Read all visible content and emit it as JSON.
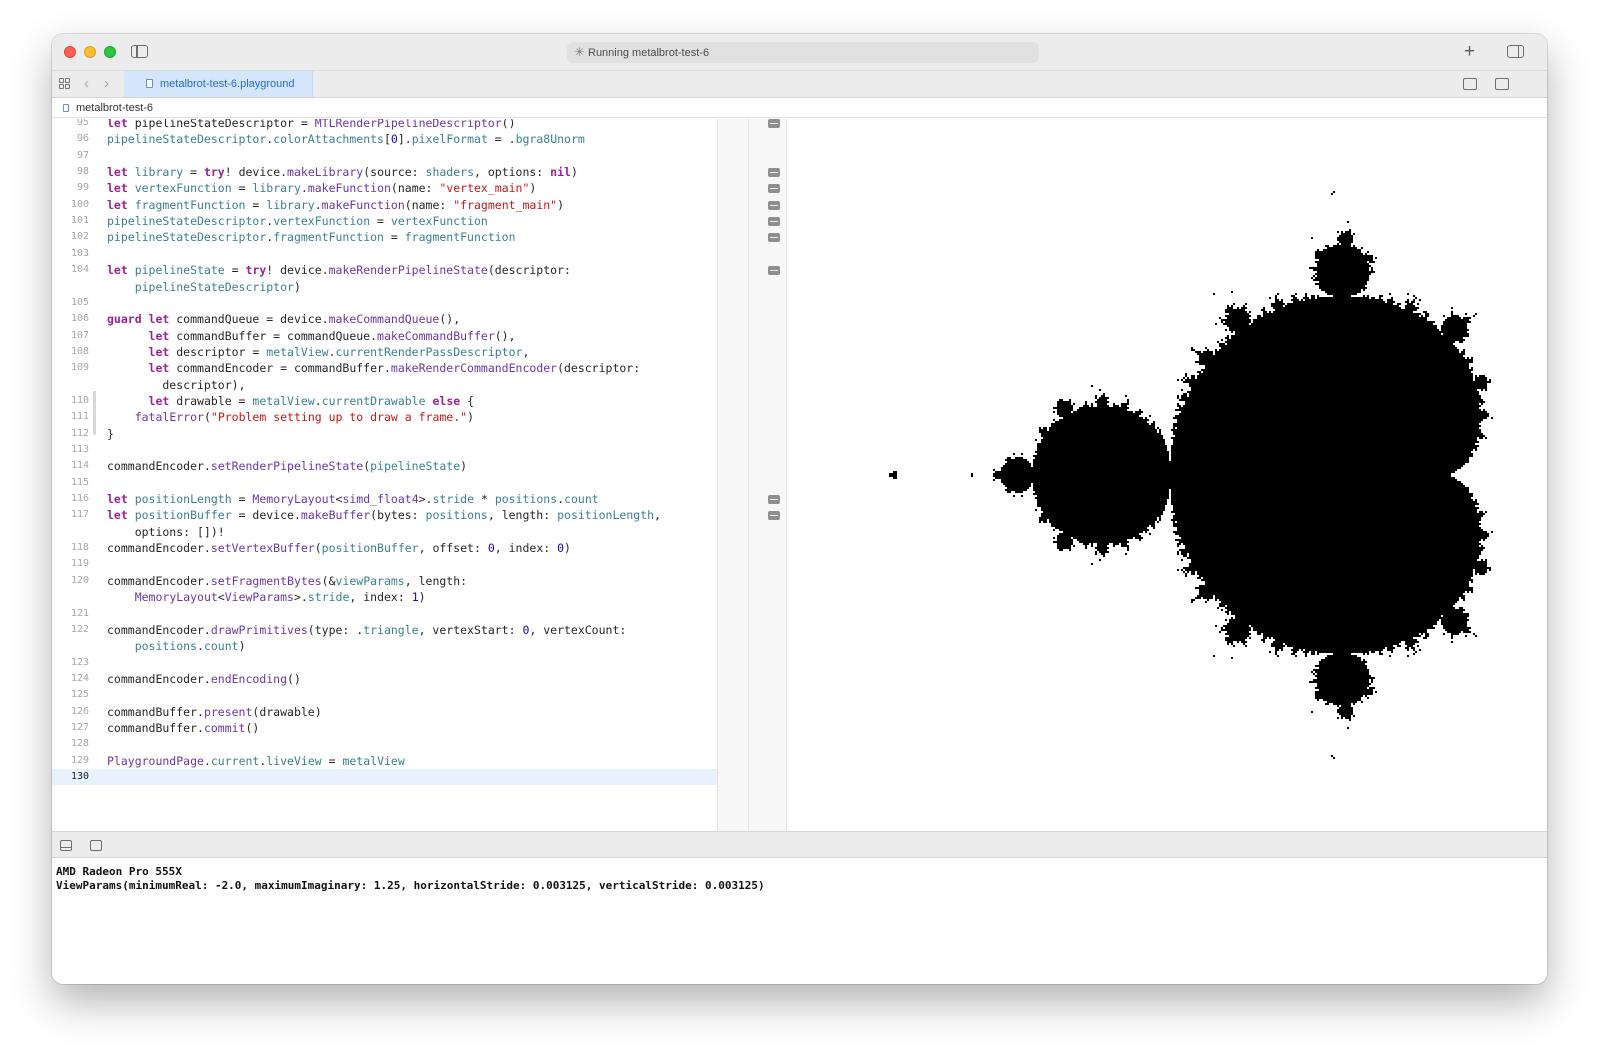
{
  "window": {
    "activity_text": "Running metalbrot-test-6",
    "tab_label": "metalbrot-test-6.playground",
    "breadcrumb": "metalbrot-test-6"
  },
  "editor": {
    "lines": [
      {
        "n": "95",
        "tokens": [
          [
            "kw",
            "let "
          ],
          [
            "pl",
            "pipelineStateDescriptor = "
          ],
          [
            "ty",
            "MTLRenderPipelineDescriptor"
          ],
          [
            "pl",
            "()"
          ]
        ]
      },
      {
        "n": "96",
        "tokens": [
          [
            "pr",
            "pipelineStateDescriptor"
          ],
          [
            "pl",
            "."
          ],
          [
            "pr",
            "colorAttachments"
          ],
          [
            "pl",
            "["
          ],
          [
            "nm",
            "0"
          ],
          [
            "pl",
            "]."
          ],
          [
            "pr",
            "pixelFormat"
          ],
          [
            "pl",
            " = ."
          ],
          [
            "pr",
            "bgra8Unorm"
          ]
        ]
      },
      {
        "n": "97",
        "tokens": []
      },
      {
        "n": "98",
        "tokens": [
          [
            "kw",
            "let "
          ],
          [
            "pr",
            "library"
          ],
          [
            "pl",
            " = "
          ],
          [
            "kw",
            "try"
          ],
          [
            "pl",
            "! device."
          ],
          [
            "fn",
            "makeLibrary"
          ],
          [
            "pl",
            "(source: "
          ],
          [
            "pr",
            "shaders"
          ],
          [
            "pl",
            ", options: "
          ],
          [
            "kw",
            "nil"
          ],
          [
            "pl",
            ")"
          ]
        ]
      },
      {
        "n": "99",
        "tokens": [
          [
            "kw",
            "let "
          ],
          [
            "pr",
            "vertexFunction"
          ],
          [
            "pl",
            " = "
          ],
          [
            "pr",
            "library"
          ],
          [
            "pl",
            "."
          ],
          [
            "fn",
            "makeFunction"
          ],
          [
            "pl",
            "(name: "
          ],
          [
            "st",
            "\"vertex_main\""
          ],
          [
            "pl",
            ")"
          ]
        ]
      },
      {
        "n": "100",
        "tokens": [
          [
            "kw",
            "let "
          ],
          [
            "pr",
            "fragmentFunction"
          ],
          [
            "pl",
            " = "
          ],
          [
            "pr",
            "library"
          ],
          [
            "pl",
            "."
          ],
          [
            "fn",
            "makeFunction"
          ],
          [
            "pl",
            "(name: "
          ],
          [
            "st",
            "\"fragment_main\""
          ],
          [
            "pl",
            ")"
          ]
        ]
      },
      {
        "n": "101",
        "tokens": [
          [
            "pr",
            "pipelineStateDescriptor"
          ],
          [
            "pl",
            "."
          ],
          [
            "pr",
            "vertexFunction"
          ],
          [
            "pl",
            " = "
          ],
          [
            "pr",
            "vertexFunction"
          ]
        ]
      },
      {
        "n": "102",
        "tokens": [
          [
            "pr",
            "pipelineStateDescriptor"
          ],
          [
            "pl",
            "."
          ],
          [
            "pr",
            "fragmentFunction"
          ],
          [
            "pl",
            " = "
          ],
          [
            "pr",
            "fragmentFunction"
          ]
        ]
      },
      {
        "n": "103",
        "tokens": []
      },
      {
        "n": "104",
        "tokens": [
          [
            "kw",
            "let "
          ],
          [
            "pr",
            "pipelineState"
          ],
          [
            "pl",
            " = "
          ],
          [
            "kw",
            "try"
          ],
          [
            "pl",
            "! device."
          ],
          [
            "fn",
            "makeRenderPipelineState"
          ],
          [
            "pl",
            "(descriptor:"
          ]
        ]
      },
      {
        "n": "",
        "tokens": [
          [
            "pl",
            "    "
          ],
          [
            "pr",
            "pipelineStateDescriptor"
          ],
          [
            "pl",
            ")"
          ]
        ]
      },
      {
        "n": "105",
        "tokens": []
      },
      {
        "n": "106",
        "tokens": [
          [
            "kw",
            "guard let "
          ],
          [
            "pl",
            "commandQueue = device."
          ],
          [
            "fn",
            "makeCommandQueue"
          ],
          [
            "pl",
            "(),"
          ]
        ]
      },
      {
        "n": "107",
        "tokens": [
          [
            "pl",
            "      "
          ],
          [
            "kw",
            "let "
          ],
          [
            "pl",
            "commandBuffer = commandQueue."
          ],
          [
            "fn",
            "makeCommandBuffer"
          ],
          [
            "pl",
            "(),"
          ]
        ]
      },
      {
        "n": "108",
        "tokens": [
          [
            "pl",
            "      "
          ],
          [
            "kw",
            "let "
          ],
          [
            "pl",
            "descriptor = "
          ],
          [
            "pr",
            "metalView"
          ],
          [
            "pl",
            "."
          ],
          [
            "pr",
            "currentRenderPassDescriptor"
          ],
          [
            "pl",
            ","
          ]
        ]
      },
      {
        "n": "109",
        "tokens": [
          [
            "pl",
            "      "
          ],
          [
            "kw",
            "let "
          ],
          [
            "pl",
            "commandEncoder = commandBuffer."
          ],
          [
            "fn",
            "makeRenderCommandEncoder"
          ],
          [
            "pl",
            "(descriptor:"
          ]
        ]
      },
      {
        "n": "",
        "tokens": [
          [
            "pl",
            "        descriptor),"
          ]
        ]
      },
      {
        "n": "110",
        "tokens": [
          [
            "pl",
            "      "
          ],
          [
            "kw",
            "let "
          ],
          [
            "pl",
            "drawable = "
          ],
          [
            "pr",
            "metalView"
          ],
          [
            "pl",
            "."
          ],
          [
            "pr",
            "currentDrawable"
          ],
          [
            "pl",
            " "
          ],
          [
            "kw",
            "else"
          ],
          [
            "pl",
            " {"
          ]
        ]
      },
      {
        "n": "111",
        "tokens": [
          [
            "pl",
            "    "
          ],
          [
            "fn",
            "fatalError"
          ],
          [
            "pl",
            "("
          ],
          [
            "st",
            "\"Problem setting up to draw a frame.\""
          ],
          [
            "pl",
            ")"
          ]
        ]
      },
      {
        "n": "112",
        "tokens": [
          [
            "pl",
            "}"
          ]
        ]
      },
      {
        "n": "113",
        "tokens": []
      },
      {
        "n": "114",
        "tokens": [
          [
            "pl",
            "commandEncoder."
          ],
          [
            "fn",
            "setRenderPipelineState"
          ],
          [
            "pl",
            "("
          ],
          [
            "pr",
            "pipelineState"
          ],
          [
            "pl",
            ")"
          ]
        ]
      },
      {
        "n": "115",
        "tokens": []
      },
      {
        "n": "116",
        "tokens": [
          [
            "kw",
            "let "
          ],
          [
            "pr",
            "positionLength"
          ],
          [
            "pl",
            " = "
          ],
          [
            "ty",
            "MemoryLayout"
          ],
          [
            "pl",
            "<"
          ],
          [
            "ty",
            "simd_float4"
          ],
          [
            "pl",
            ">."
          ],
          [
            "pr",
            "stride"
          ],
          [
            "pl",
            " * "
          ],
          [
            "pr",
            "positions"
          ],
          [
            "pl",
            "."
          ],
          [
            "pr",
            "count"
          ]
        ]
      },
      {
        "n": "117",
        "tokens": [
          [
            "kw",
            "let "
          ],
          [
            "pr",
            "positionBuffer"
          ],
          [
            "pl",
            " = device."
          ],
          [
            "fn",
            "makeBuffer"
          ],
          [
            "pl",
            "(bytes: "
          ],
          [
            "pr",
            "positions"
          ],
          [
            "pl",
            ", length: "
          ],
          [
            "pr",
            "positionLength"
          ],
          [
            "pl",
            ","
          ]
        ]
      },
      {
        "n": "",
        "tokens": [
          [
            "pl",
            "    options: [])!"
          ]
        ]
      },
      {
        "n": "118",
        "tokens": [
          [
            "pl",
            "commandEncoder."
          ],
          [
            "fn",
            "setVertexBuffer"
          ],
          [
            "pl",
            "("
          ],
          [
            "pr",
            "positionBuffer"
          ],
          [
            "pl",
            ", offset: "
          ],
          [
            "nm",
            "0"
          ],
          [
            "pl",
            ", index: "
          ],
          [
            "nm",
            "0"
          ],
          [
            "pl",
            ")"
          ]
        ]
      },
      {
        "n": "119",
        "tokens": []
      },
      {
        "n": "120",
        "tokens": [
          [
            "pl",
            "commandEncoder."
          ],
          [
            "fn",
            "setFragmentBytes"
          ],
          [
            "pl",
            "(&"
          ],
          [
            "pr",
            "viewParams"
          ],
          [
            "pl",
            ", length:"
          ]
        ]
      },
      {
        "n": "",
        "tokens": [
          [
            "pl",
            "    "
          ],
          [
            "ty",
            "MemoryLayout"
          ],
          [
            "pl",
            "<"
          ],
          [
            "ty",
            "ViewParams"
          ],
          [
            "pl",
            ">."
          ],
          [
            "pr",
            "stride"
          ],
          [
            "pl",
            ", index: "
          ],
          [
            "nm",
            "1"
          ],
          [
            "pl",
            ")"
          ]
        ]
      },
      {
        "n": "121",
        "tokens": []
      },
      {
        "n": "122",
        "tokens": [
          [
            "pl",
            "commandEncoder."
          ],
          [
            "fn",
            "drawPrimitives"
          ],
          [
            "pl",
            "(type: ."
          ],
          [
            "pr",
            "triangle"
          ],
          [
            "pl",
            ", vertexStart: "
          ],
          [
            "nm",
            "0"
          ],
          [
            "pl",
            ", vertexCount:"
          ]
        ]
      },
      {
        "n": "",
        "tokens": [
          [
            "pl",
            "    "
          ],
          [
            "pr",
            "positions"
          ],
          [
            "pl",
            "."
          ],
          [
            "pr",
            "count"
          ],
          [
            "pl",
            ")"
          ]
        ]
      },
      {
        "n": "123",
        "tokens": []
      },
      {
        "n": "124",
        "tokens": [
          [
            "pl",
            "commandEncoder."
          ],
          [
            "fn",
            "endEncoding"
          ],
          [
            "pl",
            "()"
          ]
        ]
      },
      {
        "n": "125",
        "tokens": []
      },
      {
        "n": "126",
        "tokens": [
          [
            "pl",
            "commandBuffer."
          ],
          [
            "fn",
            "present"
          ],
          [
            "pl",
            "(drawable)"
          ]
        ]
      },
      {
        "n": "127",
        "tokens": [
          [
            "pl",
            "commandBuffer."
          ],
          [
            "fn",
            "commit"
          ],
          [
            "pl",
            "()"
          ]
        ]
      },
      {
        "n": "128",
        "tokens": []
      },
      {
        "n": "129",
        "tokens": [
          [
            "ty",
            "PlaygroundPage"
          ],
          [
            "pl",
            "."
          ],
          [
            "pr",
            "current"
          ],
          [
            "pl",
            "."
          ],
          [
            "pr",
            "liveView"
          ],
          [
            "pl",
            " = "
          ],
          [
            "pr",
            "metalView"
          ]
        ]
      },
      {
        "n": "130",
        "tokens": [],
        "current": true
      }
    ]
  },
  "results_markers_rows": [
    0,
    3,
    4,
    5,
    6,
    7,
    9,
    23,
    24
  ],
  "console": {
    "lines": [
      "AMD Radeon Pro 555X",
      "ViewParams(minimumReal: -2.0, maximumImaginary: 1.25, horizontalStride: 0.003125, verticalStride: 0.003125)"
    ]
  },
  "live_view": {
    "fractal": "mandelbrot",
    "minimum_real": -2.0,
    "maximum_imaginary": 1.25,
    "stride": 0.003125,
    "set_color": "#000000",
    "background_color": "#ffffff"
  },
  "colors": {
    "keyword": "#9b2393",
    "function": "#6c36a9",
    "property": "#3a8091",
    "string": "#c41a16",
    "number": "#1c00cf",
    "tab_active": "#2a6bd1"
  }
}
